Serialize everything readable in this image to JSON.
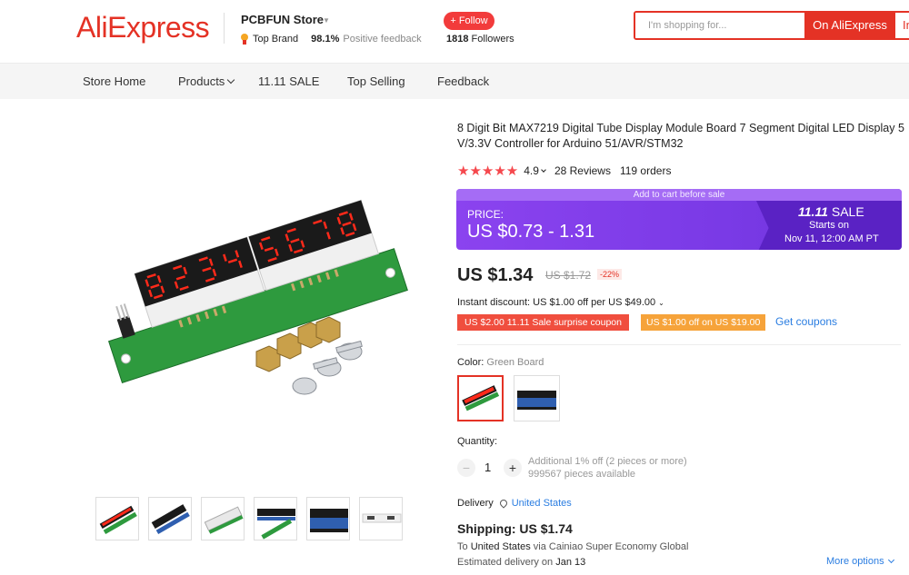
{
  "header": {
    "logo": "AliExpress",
    "store_name": "PCBFUN Store",
    "brand_label": "Top Brand",
    "feedback_pct": "98.1%",
    "feedback_label": "Positive feedback",
    "follow_label": "+ Follow",
    "followers_count": "1818",
    "followers_label": "Followers",
    "search_placeholder": "I'm shopping for...",
    "search_btn": "On AliExpress",
    "search_btn2": "In"
  },
  "nav": {
    "items": [
      "Store Home",
      "Products",
      "11.11 SALE",
      "Top Selling",
      "Feedback"
    ]
  },
  "product": {
    "title": "8 Digit Bit MAX7219 Digital Tube Display Module Board 7 Segment Digital LED Display 5V/3.3V Controller for Arduino 51/AVR/STM32",
    "stars": "★★★★★",
    "rating": "4.9",
    "reviews": "28 Reviews",
    "orders": "119 orders",
    "display_digits": "12345678"
  },
  "sale": {
    "topline": "Add to cart before sale",
    "price_label": "PRICE:",
    "price_range": "US $0.73 - 1.31",
    "event_num": "11.11",
    "event_word": "SALE",
    "starts_label": "Starts on",
    "start_date": "Nov 11, 12:00 AM PT"
  },
  "price": {
    "current": "US $1.34",
    "original": "US $1.72",
    "discount": "-22%",
    "instant": "Instant discount: US $1.00 off per US $49.00",
    "coupon1": "US $2.00 11.11 Sale surprise coupon",
    "coupon2": "US $1.00 off on US $19.00",
    "get_coupons": "Get coupons"
  },
  "variant": {
    "label": "Color:",
    "selected": "Green Board"
  },
  "quantity": {
    "label": "Quantity:",
    "minus": "−",
    "value": "1",
    "plus": "+",
    "note1": "Additional 1% off (2 pieces or more)",
    "note2": "999567 pieces available"
  },
  "delivery": {
    "label": "Delivery",
    "country": "United States",
    "shipping": "Shipping: US $1.74",
    "to_prefix": "To",
    "to_country": "United States",
    "via": "via Cainiao Super Economy Global",
    "est_prefix": "Estimated delivery on",
    "est_date": "Jan 13",
    "more_options": "More options"
  },
  "colors": {
    "brand_red": "#e43225",
    "sale_purple": "#8b43ef",
    "star_red": "#f5484d",
    "link_blue": "#2a7de1",
    "coupon_red": "#f04e3e",
    "coupon_orange": "#f6a33a",
    "pcb_green": "#2e9a3e",
    "led_red": "#ff2a1a"
  }
}
